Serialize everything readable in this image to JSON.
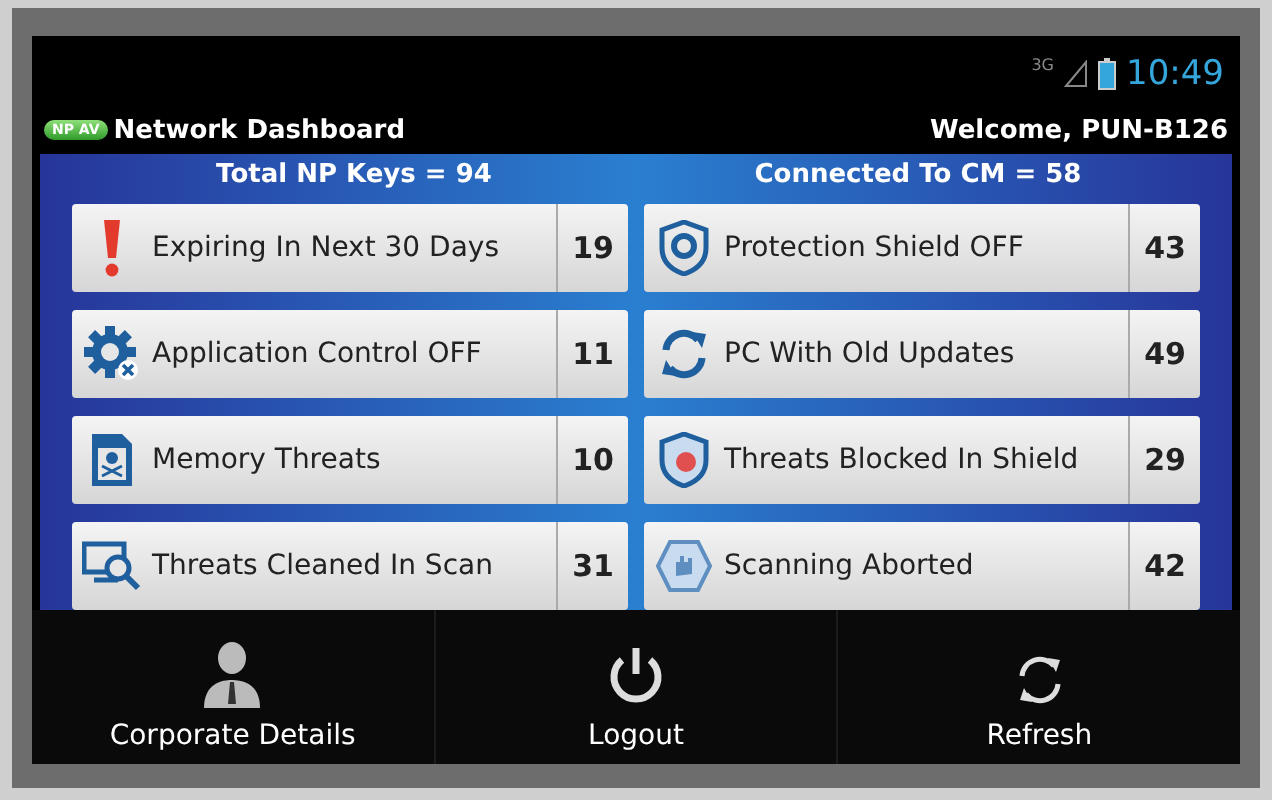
{
  "status_bar": {
    "network": "3G",
    "time": "10:49"
  },
  "app_bar": {
    "badge": "NP AV",
    "title": "Network Dashboard",
    "welcome": "Welcome, PUN-B126"
  },
  "summary": {
    "left": "Total NP Keys = 94",
    "right": "Connected To CM = 58"
  },
  "tiles": [
    {
      "label": "Expiring In Next 30 Days",
      "count": "19"
    },
    {
      "label": "Protection Shield OFF",
      "count": "43"
    },
    {
      "label": "Application Control OFF",
      "count": "11"
    },
    {
      "label": "PC With Old Updates",
      "count": "49"
    },
    {
      "label": "Memory Threats",
      "count": "10"
    },
    {
      "label": "Threats Blocked In Shield",
      "count": "29"
    },
    {
      "label": "Threats Cleaned In Scan",
      "count": "31"
    },
    {
      "label": "Scanning Aborted",
      "count": "42"
    }
  ],
  "menu": [
    {
      "label": "Corporate Details"
    },
    {
      "label": "Logout"
    },
    {
      "label": "Refresh"
    }
  ]
}
